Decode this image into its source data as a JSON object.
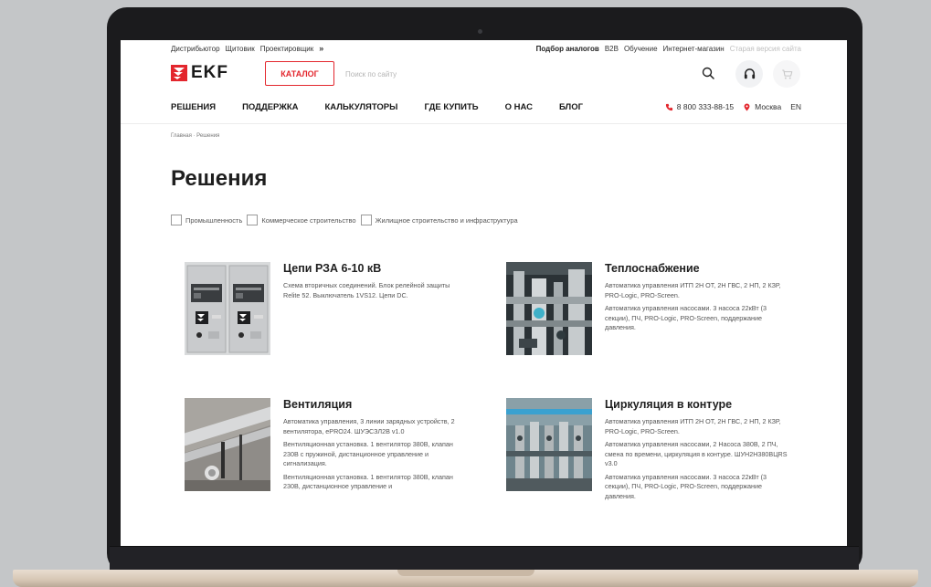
{
  "toplinks": {
    "left": [
      "Дистрибьютор",
      "Щитовик",
      "Проектировщик"
    ],
    "more": "»",
    "right_bold": "Подбор аналогов",
    "right": [
      "B2B",
      "Обучение",
      "Интернет-магазин"
    ],
    "old_site": "Старая версия сайта"
  },
  "logo": {
    "text": "EKF"
  },
  "catalog_label": "КАТАЛОГ",
  "search": {
    "placeholder": "Поиск по сайту"
  },
  "nav": [
    "РЕШЕНИЯ",
    "ПОДДЕРЖКА",
    "КАЛЬКУЛЯТОРЫ",
    "ГДЕ КУПИТЬ",
    "О НАС",
    "БЛОГ"
  ],
  "contacts": {
    "phone": "8 800 333-88-15",
    "city": "Москва",
    "lang": "EN"
  },
  "breadcrumb": "Главная · Решения",
  "page_title": "Решения",
  "filters": [
    "Промышленность",
    "Коммерческое строительство",
    "Жилищное строительство и инфраструктура"
  ],
  "cards": [
    {
      "title": "Цепи РЗА 6-10 кВ",
      "desc": [
        "Схема вторичных соединений. Блок релейной защиты Relite 52. Выключатель 1VS12. Цепи DC."
      ]
    },
    {
      "title": "Теплоснабжение",
      "desc": [
        "Автоматика управления ИТП 2Н ОТ, 2Н ГВС, 2 НП, 2 КЗР, PRO-Logic, PRO-Screen.",
        "Автоматика управления насосами. 3 насоса 22кВт (3 секции), ПЧ, PRO-Logic, PRO-Screen, поддержание давления."
      ]
    },
    {
      "title": "Вентиляция",
      "desc": [
        "Автоматика управления, 3 линии зарядных устройств, 2 вентилятора, ePRO24. ШУЭСЗЛ2В v1.0",
        "Вентиляционная установка. 1 вентилятор 380В, клапан 230В с пружиной, дистанционное управление и сигнализация.",
        "Вентиляционная установка. 1 вентилятор 380В, клапан 230В, дистанционное управление и"
      ]
    },
    {
      "title": "Циркуляция в контуре",
      "desc": [
        "Автоматика управления ИТП 2Н ОТ, 2Н ГВС, 2 НП, 2 КЗР, PRO-Logic, PRO-Screen.",
        "Автоматика управления насосами, 2 Насоса 380В, 2 ПЧ, смена по времени, циркуляция в контуре. ШУН2Н380ВЦRS v3.0",
        "Автоматика управления насосами. 3 насоса 22кВт (3 секции), ПЧ, PRO-Logic, PRO-Screen, поддержание давления."
      ]
    }
  ],
  "colors": {
    "accent": "#e3262d",
    "text": "#1f1f1f",
    "muted": "#c0c0c0"
  }
}
